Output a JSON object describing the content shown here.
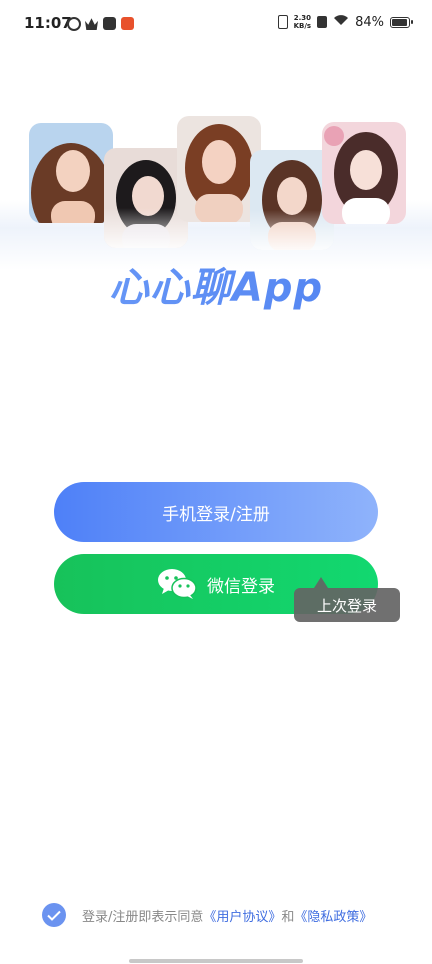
{
  "status_bar": {
    "time": "11:07",
    "net_speed_value": "2.30",
    "net_speed_unit": "KB/s",
    "battery_percent": "84%",
    "battery_level": 0.84
  },
  "header": {
    "app_title": "心心聊App"
  },
  "actions": {
    "phone_login_label": "手机登录/注册",
    "wechat_login_label": "微信登录",
    "last_login_tooltip": "上次登录"
  },
  "agreement": {
    "checked": true,
    "prefix": "登录/注册即表示同意",
    "user_agreement": "《用户协议》",
    "and": "和",
    "privacy_policy": "《隐私政策》"
  },
  "colors": {
    "brand_blue": "#4e80f8",
    "wechat_green": "#17c25a",
    "link_blue": "#3f6de0"
  }
}
